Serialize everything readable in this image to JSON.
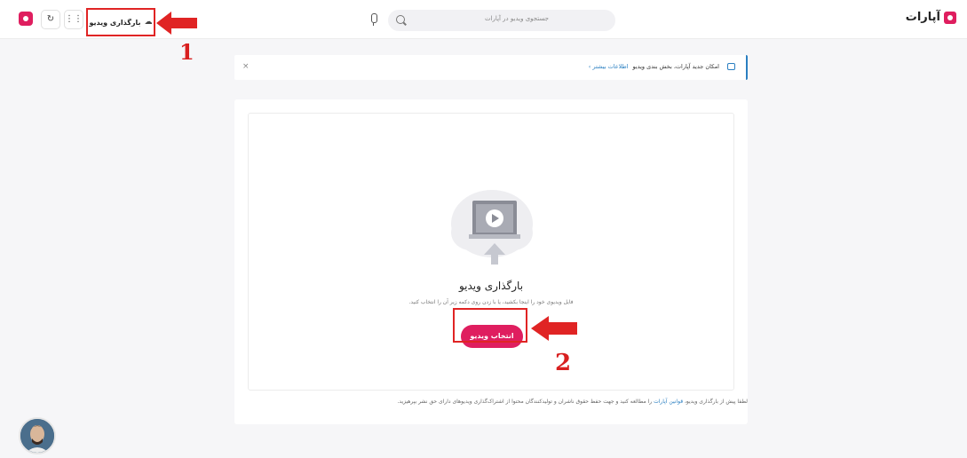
{
  "header": {
    "logo_text": "آپارات",
    "search_placeholder": "جستجوی ویدیو در آپارات",
    "upload_label": "بارگذاری ویدیو",
    "icons": [
      "search-icon",
      "microphone-icon",
      "apps-grid-icon",
      "history-icon",
      "aparat-logo-icon",
      "cloud-upload-icon"
    ]
  },
  "notice": {
    "text": "امکان جدید آپارات، بخش بندی ویدیو",
    "link": "اطلاعات بیشتر ›",
    "close": "×"
  },
  "upload": {
    "title": "بارگذاری ویدیو",
    "subtitle": "فایل ویدیوی خود را اینجا بکشید، یا با زدن روی دکمه زیر آن را انتخاب کنید.",
    "button": "انتخاب ویدیو"
  },
  "terms": {
    "before": "لطفا پیش از بارگذاری ویدیو، ",
    "link": "قوانین آپارات",
    "after": " را مطالعه کنید و جهت حفظ حقوق ناشران و تولیدکنندگان محتوا از اشتراک‌گذاری ویدیوهای دارای حق نشر بپرهیزید."
  },
  "annotations": {
    "step1": "1",
    "step2": "2"
  },
  "colors": {
    "brand": "#df1e5f",
    "link": "#2a7fc1",
    "annotation": "#e02424"
  }
}
